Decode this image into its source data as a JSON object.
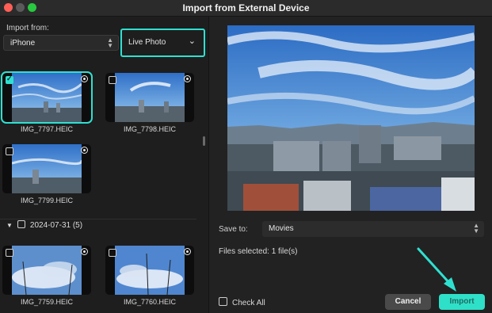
{
  "window": {
    "title": "Import from External Device"
  },
  "left": {
    "import_from_label": "Import from:",
    "device_value": "iPhone",
    "filter_value": "Live Photo",
    "items": [
      {
        "name": "IMG_7797.HEIC",
        "checked": true
      },
      {
        "name": "IMG_7798.HEIC",
        "checked": false
      },
      {
        "name": "IMG_7799.HEIC",
        "checked": false
      },
      {
        "name": "IMG_7759.HEIC",
        "checked": false
      },
      {
        "name": "IMG_7760.HEIC",
        "checked": false
      }
    ],
    "group_label": "2024-07-31 (5)"
  },
  "right": {
    "save_to_label": "Save to:",
    "save_to_value": "Movies",
    "files_selected": "Files selected: 1 file(s)",
    "check_all_label": "Check All",
    "cancel_label": "Cancel",
    "import_label": "Import"
  },
  "colors": {
    "accent": "#2fe0d0",
    "background": "#1e1e1e"
  }
}
